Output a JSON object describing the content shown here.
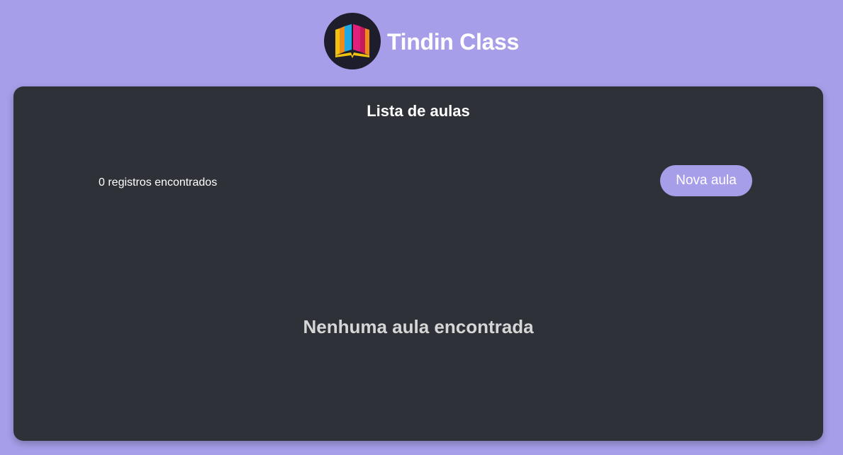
{
  "header": {
    "app_title": "Tindin Class",
    "logo_icon": "open-book-icon"
  },
  "main": {
    "title": "Lista de aulas",
    "records_count": "0 registros encontrados",
    "new_button_label": "Nova aula",
    "empty_message": "Nenhuma aula encontrada"
  },
  "colors": {
    "background": "#a69ee8",
    "card": "#2f3139",
    "accent": "#a69ee8",
    "text": "#ffffff",
    "muted_text": "#d6d6d6"
  }
}
